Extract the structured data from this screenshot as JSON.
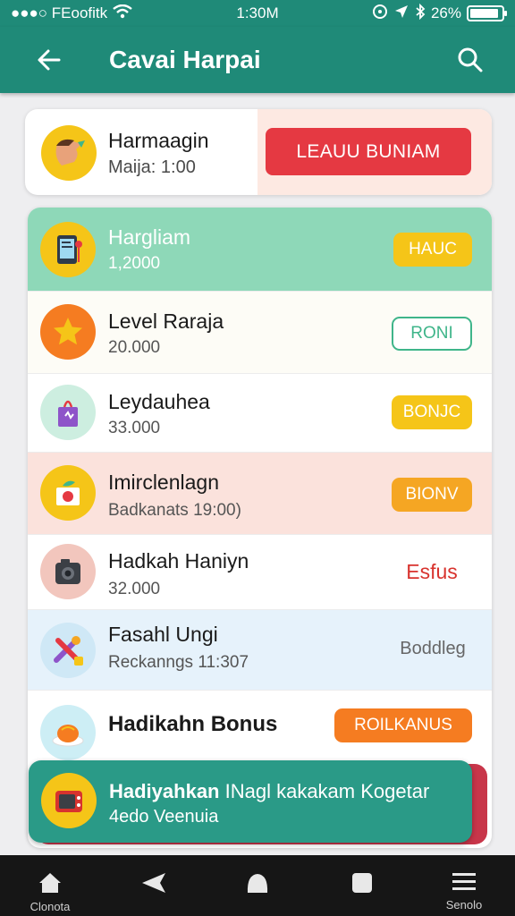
{
  "status_bar": {
    "carrier": "●●●○ FEoofitk",
    "time": "1:30M",
    "battery": "26%",
    "battery_level": 0.9
  },
  "app_bar": {
    "title": "Cavai Harpai"
  },
  "top_card": {
    "title": "Harmaagin",
    "subtitle": "Maija: 1:00",
    "cta_label": "LEAUU BUNIAM"
  },
  "items": [
    {
      "title": "Hargliam",
      "subtitle": "1,2000",
      "button": "HAUC",
      "icon": "phone-icon",
      "bg": "#8ed8b8",
      "title_color": "#ffffff",
      "subtitle_color": "#ffffff"
    },
    {
      "title": "Level Raraja",
      "subtitle": "20.000",
      "button": "RONI",
      "icon": "star-icon",
      "bg": "#fdfcf6"
    },
    {
      "title": "Leydauhea",
      "subtitle": "33.000",
      "button": "BONJC",
      "icon": "gift-bag-icon",
      "bg": "#ffffff"
    },
    {
      "title": "Imirclenlagn",
      "subtitle": "Badkanats 19:00)",
      "button": "BIONV",
      "icon": "fruit-box-icon",
      "bg": "#fbe2dc"
    },
    {
      "title": "Hadkah Haniyn",
      "subtitle": "32.000",
      "button": "Esfus",
      "icon": "camera-icon",
      "bg": "#ffffff"
    },
    {
      "title": "Fasahl Ungi",
      "subtitle": "Reckanngs 11:307",
      "button": "Boddleg",
      "icon": "tools-icon",
      "bg": "#e6f2fb"
    },
    {
      "title": "Hadikahn Bonus",
      "subtitle": "",
      "button": "ROILKANUS",
      "icon": "food-plate-icon",
      "bg": "#ffffff"
    }
  ],
  "banner": {
    "title_bold": "Hadiyahkan",
    "title_rest": " INagl kakakam Kogetar",
    "subtitle": "4edo Veenuia"
  },
  "nav": [
    {
      "label": "Clonota",
      "icon": "home-icon"
    },
    {
      "label": "",
      "icon": "back-icon"
    },
    {
      "label": "",
      "icon": "circle-icon"
    },
    {
      "label": "",
      "icon": "square-icon"
    },
    {
      "label": "Senolo",
      "icon": "menu-icon"
    }
  ],
  "colors": {
    "primary": "#1f8a78",
    "danger": "#e53942",
    "accent_yellow": "#f5c518",
    "accent_orange": "#f57c21",
    "accent_green": "#3fb58a"
  }
}
